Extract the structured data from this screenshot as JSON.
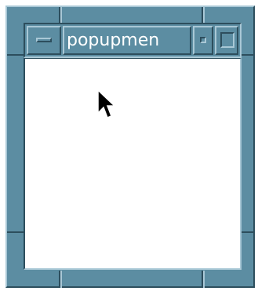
{
  "window": {
    "title": "popupmen",
    "frame_color": "#5c8da2",
    "highlight_color": "#a9c8d6",
    "shadow_color": "#2d4e5d",
    "client_background": "#ffffff"
  },
  "titlebar": {
    "menu_button_icon": "window-menu-icon",
    "minimize_button_icon": "minimize-icon",
    "maximize_button_icon": "maximize-icon"
  },
  "cursor": {
    "icon": "arrow-pointer-icon"
  }
}
